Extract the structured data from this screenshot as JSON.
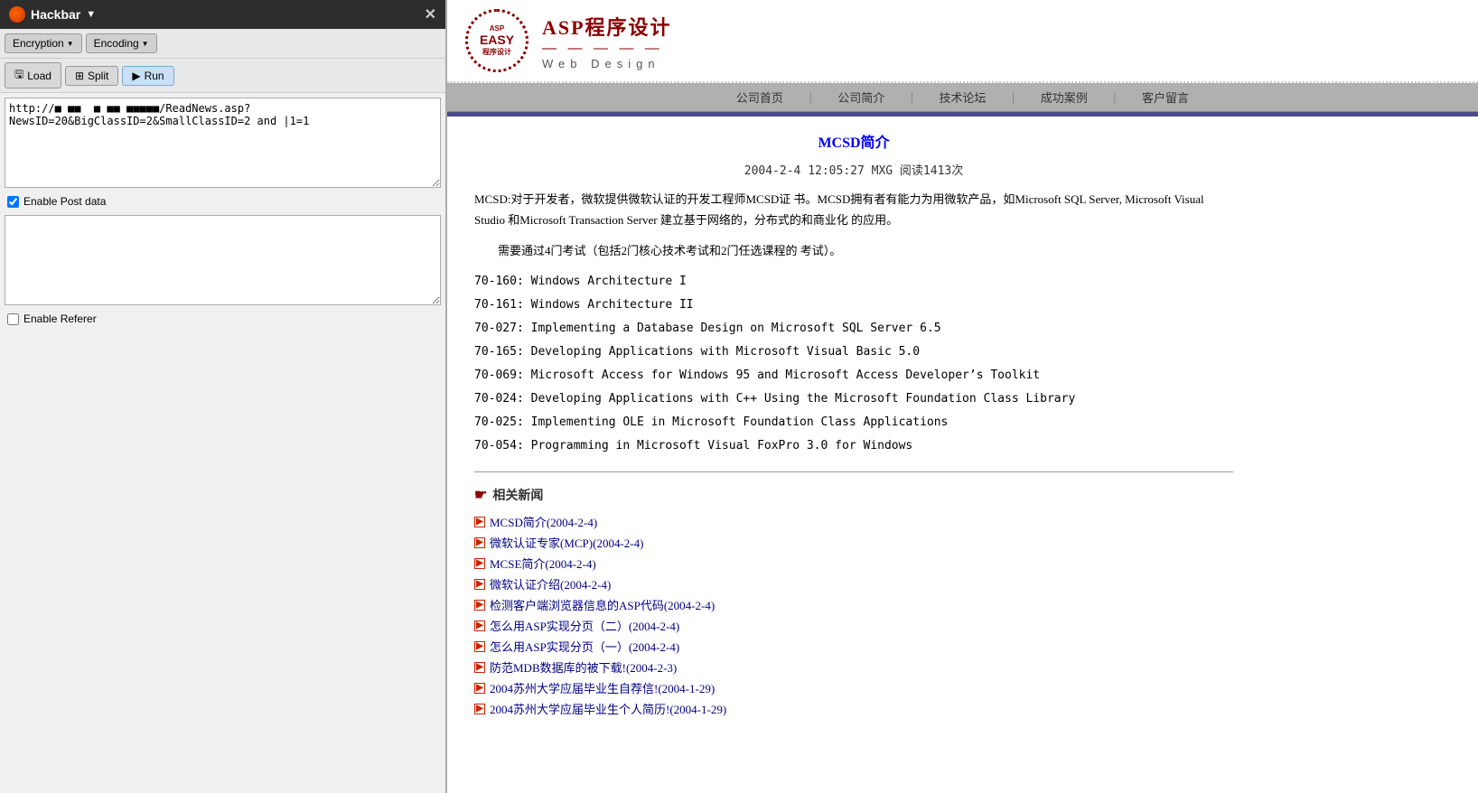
{
  "hackbar": {
    "title": "Hackbar",
    "title_arrow": "▼",
    "encryption_label": "Encryption",
    "encoding_label": "Encoding",
    "load_label": "Load",
    "split_label": "Split",
    "run_label": "Run",
    "url_value": "http://■ ■■  ■ ■■ ■■■■■/ReadNews.asp?NewsID=20&BigClassID=2&SmallClassID=2 and |1=1",
    "enable_post_label": "Enable Post data",
    "post_value": "",
    "enable_referer_label": "Enable Referer"
  },
  "asp_site": {
    "logo_top": "ASP",
    "logo_easy": "EASY",
    "logo_bottom": "程序设计",
    "main_title": "ASP程序设计",
    "title_dashes": "— — — — —",
    "subtitle": "Web  Design",
    "nav_items": [
      "公司首页",
      "公司简介",
      "技术论坛",
      "成功案例",
      "客户留言"
    ],
    "article": {
      "title": "MCSD简介",
      "meta": "2004-2-4  12:05:27          MXG      阅读1413次",
      "para1": "MCSD:对于开发者，微软提供微软认证的开发工程师MCSD证 书。MCSD拥有者有能力为用微软产品，如Microsoft SQL Server, Microsoft Visual Studio 和Microsoft Transaction Server 建立基于网络的，分布式的和商业化 的应用。",
      "para2": "需要通过4门考试（包括2门核心技术考试和2门任选课程的 考试）。",
      "courses": [
        "70-160: Windows Architecture I",
        "70-161: Windows Architecture II",
        "70-027: Implementing a Database Design on Microsoft SQL Server 6.5",
        "70-165: Developing Applications with Microsoft Visual Basic 5.0",
        "70-069: Microsoft Access for Windows 95 and Microsoft Access Developer's Toolkit",
        "70-024: Developing Applications with C++ Using the Microsoft Foundation Class Library",
        "70-025: Implementing OLE in Microsoft Foundation Class Applications",
        "70-054: Programming in Microsoft Visual FoxPro 3.0 for Windows"
      ],
      "related_title": "相关新闻",
      "related_links": [
        {
          "text": "MCSD简介(2004-2-4)",
          "date": ""
        },
        {
          "text": "微软认证专家(MCP)(2004-2-4)",
          "date": ""
        },
        {
          "text": "MCSE简介(2004-2-4)",
          "date": ""
        },
        {
          "text": "微软认证介绍(2004-2-4)",
          "date": ""
        },
        {
          "text": "检测客户端浏览器信息的ASP代码(2004-2-4)",
          "date": ""
        },
        {
          "text": "怎么用ASP实现分页（二）(2004-2-4)",
          "date": ""
        },
        {
          "text": "怎么用ASP实现分页（一）(2004-2-4)",
          "date": ""
        },
        {
          "text": "防范MDB数据库的被下载!(2004-2-3)",
          "date": ""
        },
        {
          "text": "2004苏州大学应届毕业生自荐信!(2004-1-29)",
          "date": ""
        },
        {
          "text": "2004苏州大学应届毕业生个人简历!(2004-1-29)",
          "date": ""
        }
      ]
    }
  }
}
